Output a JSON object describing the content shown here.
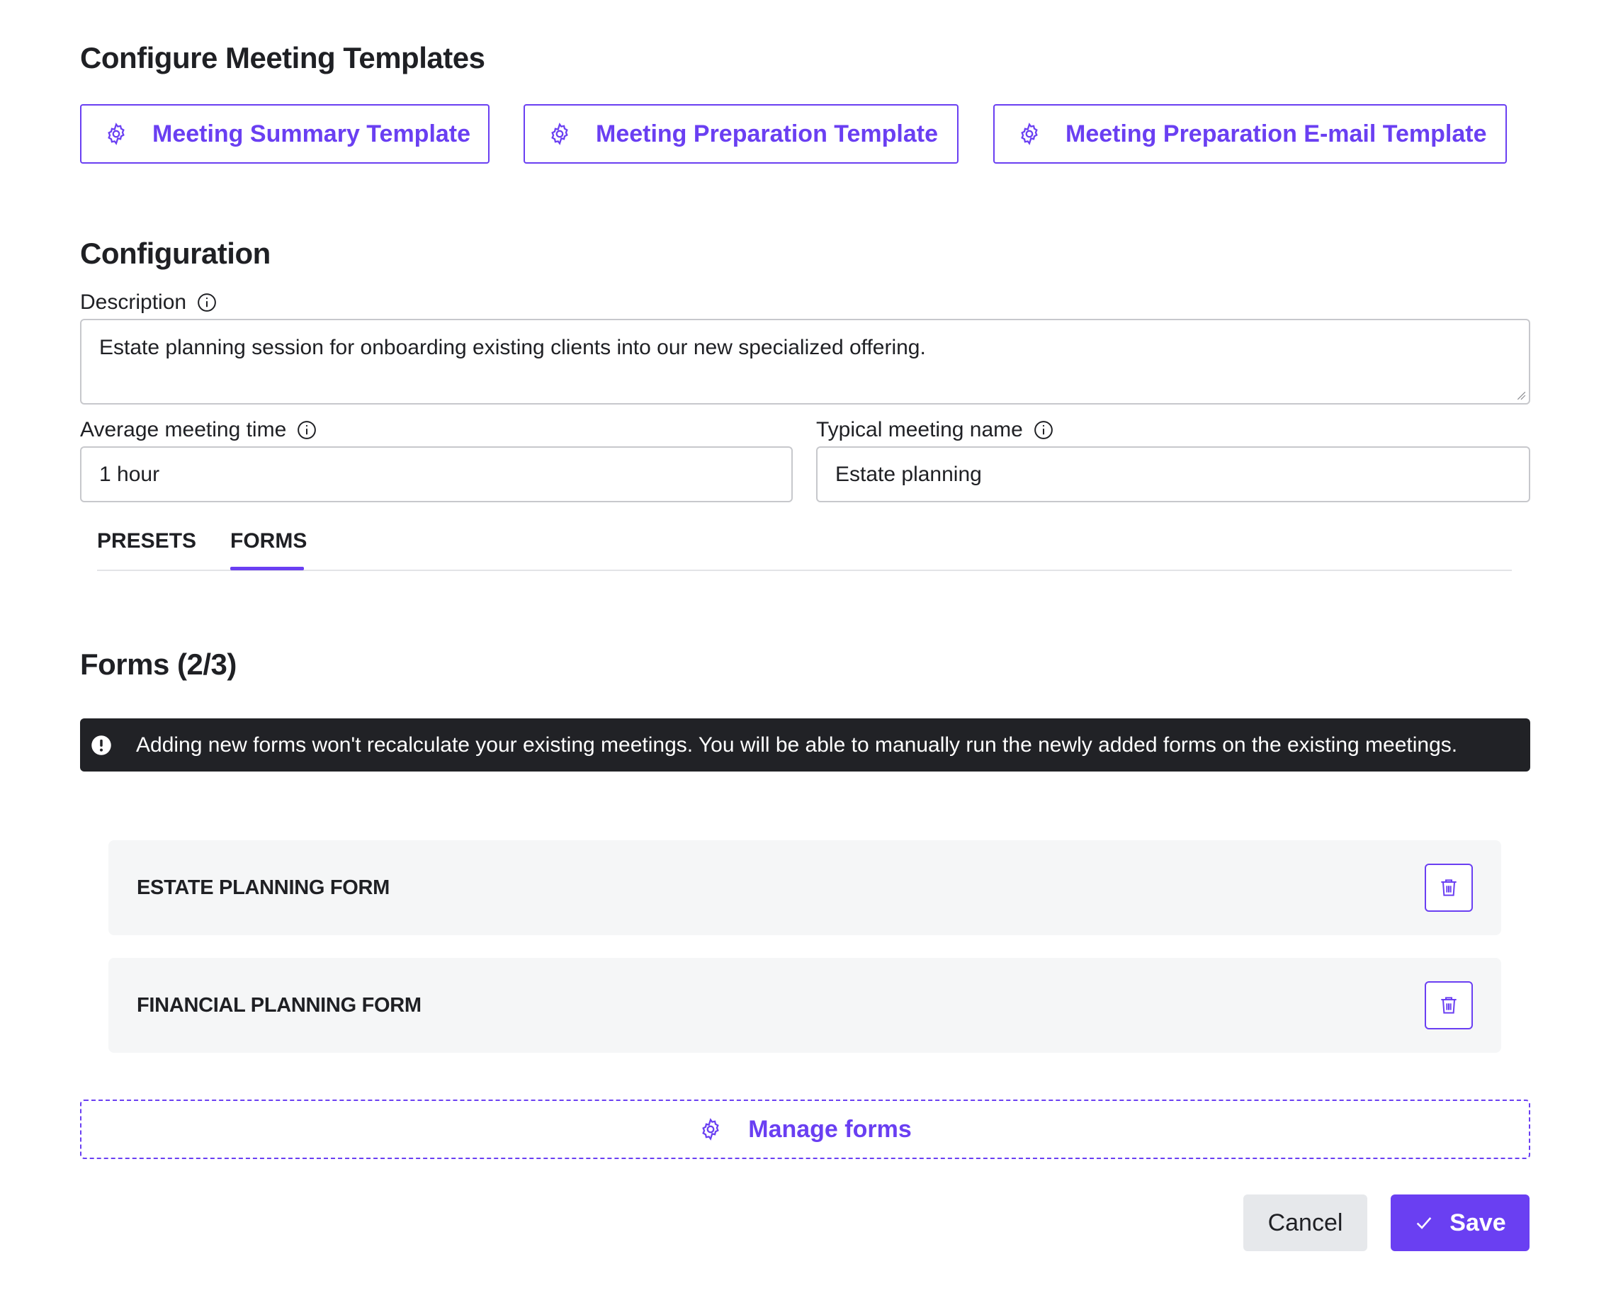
{
  "page": {
    "title": "Configure Meeting Templates"
  },
  "templates": [
    {
      "label": "Meeting Summary Template",
      "icon": "gear-icon"
    },
    {
      "label": "Meeting Preparation Template",
      "icon": "gear-icon"
    },
    {
      "label": "Meeting Preparation E-mail Template",
      "icon": "gear-icon"
    }
  ],
  "configuration": {
    "heading": "Configuration",
    "description": {
      "label": "Description",
      "value": "Estate planning session for onboarding existing clients into our new specialized offering."
    },
    "average_time": {
      "label": "Average meeting time",
      "value": "1 hour"
    },
    "meeting_name": {
      "label": "Typical meeting name",
      "value": "Estate planning"
    }
  },
  "tabs": [
    {
      "label": "PRESETS",
      "active": false
    },
    {
      "label": "FORMS",
      "active": true
    }
  ],
  "forms": {
    "heading": "Forms (2/3)",
    "alert": "Adding new forms won't recalculate your existing meetings. You will be able to manually run the newly added forms on the existing meetings.",
    "items": [
      {
        "name": "ESTATE PLANNING FORM"
      },
      {
        "name": "FINANCIAL PLANNING FORM"
      }
    ],
    "manage_label": "Manage forms"
  },
  "actions": {
    "cancel_label": "Cancel",
    "save_label": "Save"
  },
  "colors": {
    "accent": "#6a3ff2",
    "alert_bg": "#212226",
    "row_bg": "#f5f6f7",
    "cancel_bg": "#e6e8eb"
  }
}
